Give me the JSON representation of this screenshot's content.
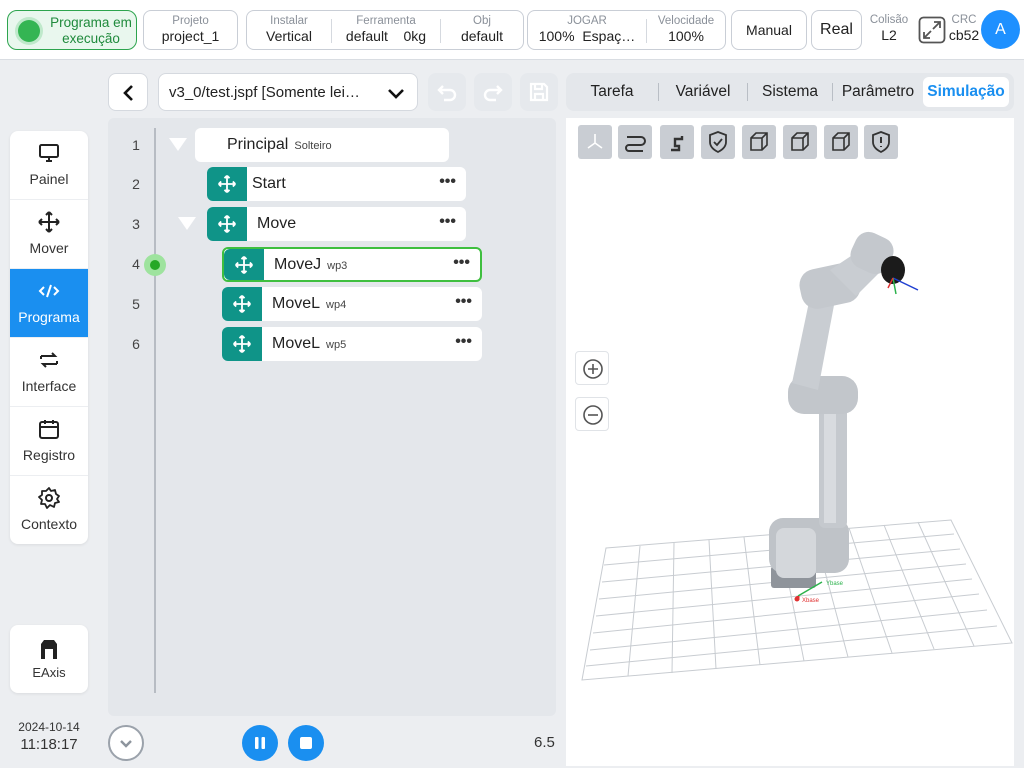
{
  "topbar": {
    "status": "Programa em execução",
    "project": {
      "label": "Projeto",
      "value": "project_1"
    },
    "install": {
      "label": "Instalar",
      "value": "Vertical"
    },
    "tool": {
      "label": "Ferramenta",
      "value": "default",
      "extra": "0kg"
    },
    "obj": {
      "label": "Obj",
      "value": "default"
    },
    "jog": {
      "label": "JOGAR",
      "value": "100%",
      "extra": "Espaç…"
    },
    "speed": {
      "label": "Velocidade",
      "value": "100%"
    },
    "manual_label": "Manual",
    "real_label": "Real",
    "collision": {
      "label": "Colisão",
      "value": "L2"
    },
    "crc": {
      "label": "CRC",
      "value": "cb52"
    },
    "avatar_letter": "A",
    "status_color": "#2da44e",
    "accent_color": "#1a8ff0"
  },
  "nav": {
    "items": [
      {
        "label": "Painel",
        "icon": "monitor-icon"
      },
      {
        "label": "Mover",
        "icon": "move-icon"
      },
      {
        "label": "Programa",
        "icon": "code-icon",
        "active": true
      },
      {
        "label": "Interface",
        "icon": "swap-icon"
      },
      {
        "label": "Registro",
        "icon": "calendar-icon"
      },
      {
        "label": "Contexto",
        "icon": "gear-icon"
      }
    ],
    "eaxis_label": "EAxis",
    "date": "2024-10-14",
    "time": "11:18:17"
  },
  "program": {
    "file": "v3_0/test.jspf [Somente lei…",
    "line_numbers": [
      "1",
      "2",
      "3",
      "4",
      "5",
      "6"
    ],
    "nodes": {
      "main": {
        "label": "Principal",
        "sub": "Solteiro"
      },
      "start": {
        "label": "Start"
      },
      "move": {
        "label": "Move"
      },
      "movej": {
        "label": "MoveJ",
        "sub": "wp3"
      },
      "movel1": {
        "label": "MoveL",
        "sub": "wp4"
      },
      "movel2": {
        "label": "MoveL",
        "sub": "wp5"
      }
    },
    "more_glyph": "•••",
    "current_line": 4,
    "version": "6.5",
    "node_color": "#0f9488"
  },
  "tabs": {
    "items": [
      "Tarefa",
      "Variável",
      "Sistema",
      "Parâmetro",
      "Simulação"
    ],
    "active": "Simulação"
  },
  "simulation": {
    "toolbar_icons": [
      "axes-view-icon",
      "path-icon",
      "robot-view-icon",
      "shield-check-icon",
      "cube-front-icon",
      "cube-side-icon",
      "cube-top-icon",
      "shield-alert-icon"
    ],
    "x_label": "Xbase",
    "y_label": "Ybase"
  }
}
